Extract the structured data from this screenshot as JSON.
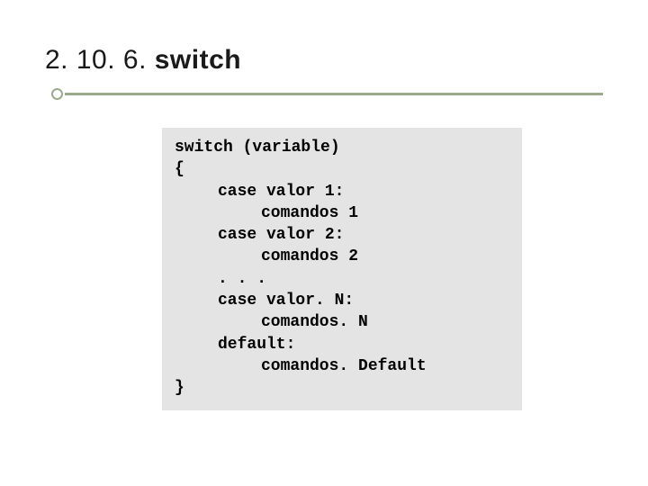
{
  "heading": {
    "prefix": "2. 10. 6. ",
    "title": "switch"
  },
  "code": {
    "l0": "switch (variable)",
    "l1": "{",
    "l2": "case valor 1:",
    "l3": "comandos 1",
    "l4": "case valor 2:",
    "l5": "comandos 2",
    "l6": ". . .",
    "l7": "case valor. N:",
    "l8": "comandos. N",
    "l9": "default:",
    "l10": "comandos. Default",
    "l11": "}"
  }
}
